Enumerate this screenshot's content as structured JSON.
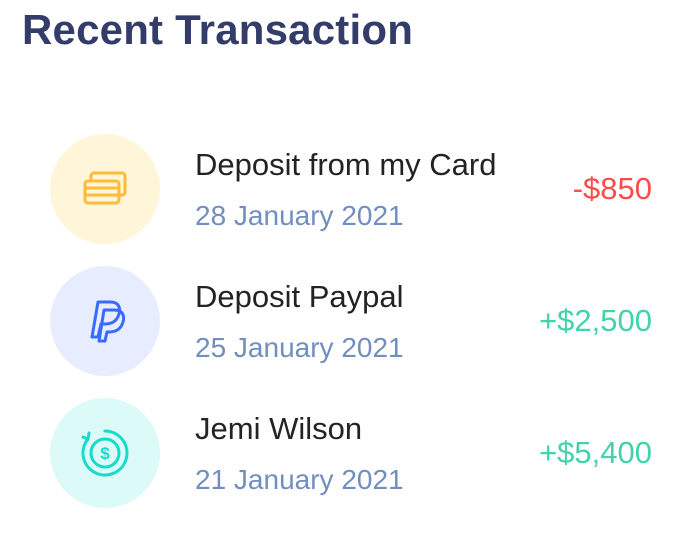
{
  "card": {
    "title": "Recent Transaction"
  },
  "transactions": [
    {
      "name": "Deposit from my Card",
      "date": "28 January 2021",
      "amount": "-$850",
      "amount_color": "#ff4b4a",
      "icon": "credit-card-icon",
      "icon_bg": "#fff5d9",
      "icon_color": "#ffbb38"
    },
    {
      "name": "Deposit Paypal",
      "date": "25 January 2021",
      "amount": "+$2,500",
      "amount_color": "#41d4a8",
      "icon": "paypal-icon",
      "icon_bg": "#e7edff",
      "icon_color": "#396aff"
    },
    {
      "name": "Jemi Wilson",
      "date": "21 January 2021",
      "amount": "+$5,400",
      "amount_color": "#41d4a8",
      "icon": "dollar-coin-icon",
      "icon_bg": "#dcfaf8",
      "icon_color": "#16dbcc"
    }
  ]
}
